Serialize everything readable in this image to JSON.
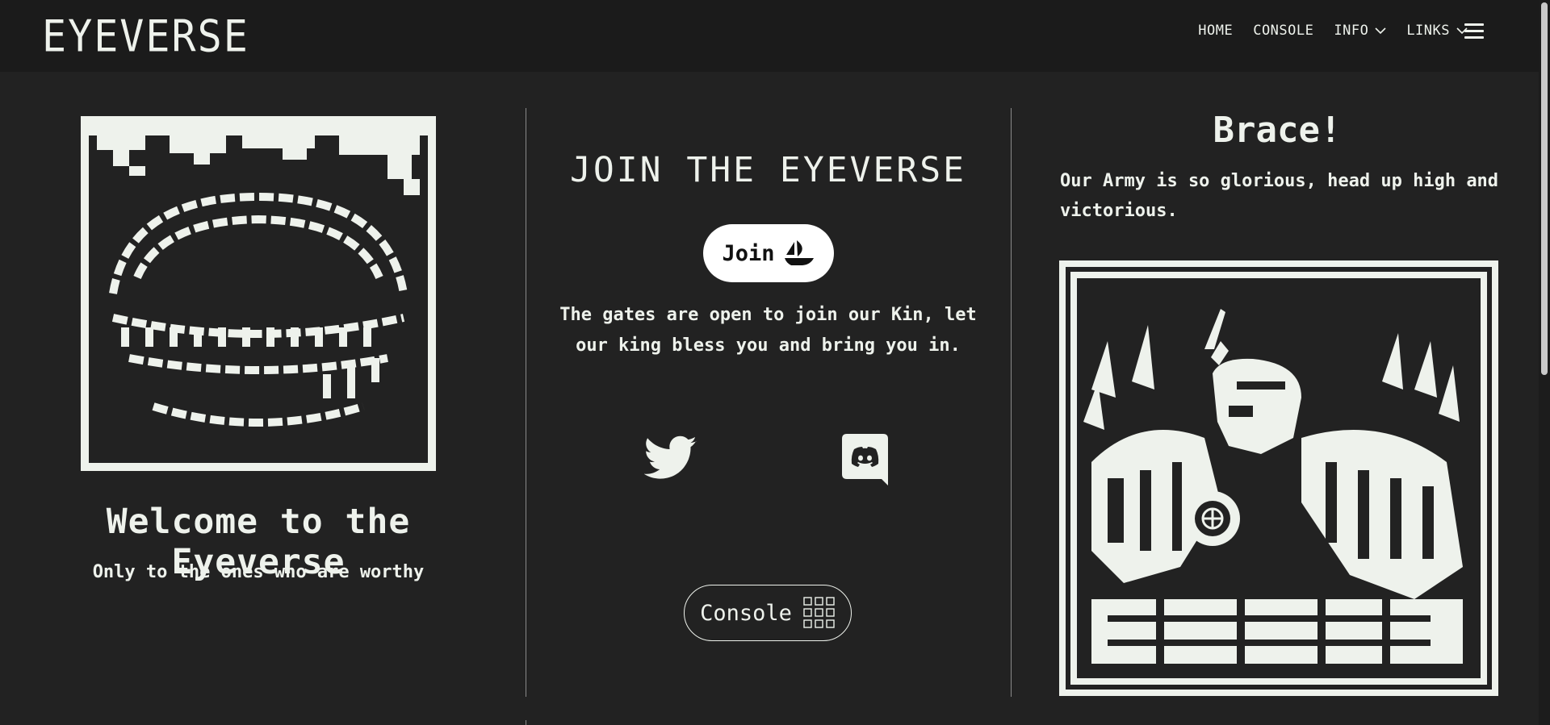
{
  "header": {
    "brand": "EYEVERSE",
    "nav": [
      {
        "label": "HOME",
        "dropdown": false
      },
      {
        "label": "CONSOLE",
        "dropdown": false
      },
      {
        "label": "INFO",
        "dropdown": true
      },
      {
        "label": "LINKS",
        "dropdown": true
      }
    ],
    "menu_icon": "hamburger-icon"
  },
  "left": {
    "art_icon": "pixel-mouth-icon",
    "title": "Welcome to the Eyeverse",
    "subtitle": "Only to the ones who are worthy"
  },
  "middle": {
    "title": "JOIN THE EYEVERSE",
    "join_button": "Join",
    "join_icon": "opensea-ship-icon",
    "description": "The gates are open to join our Kin, let our king bless you and bring you in.",
    "social_icons": [
      "twitter-icon",
      "discord-icon"
    ],
    "console_button": "Console",
    "console_icon": "grid-icon"
  },
  "right": {
    "title": "Brace!",
    "description": "Our Army is so glorious, head up high and victorious.",
    "art_icon": "pixel-knight-icon"
  },
  "colors": {
    "background": "#222222",
    "header": "#1b1b1b",
    "foreground": "#eef2ec"
  }
}
